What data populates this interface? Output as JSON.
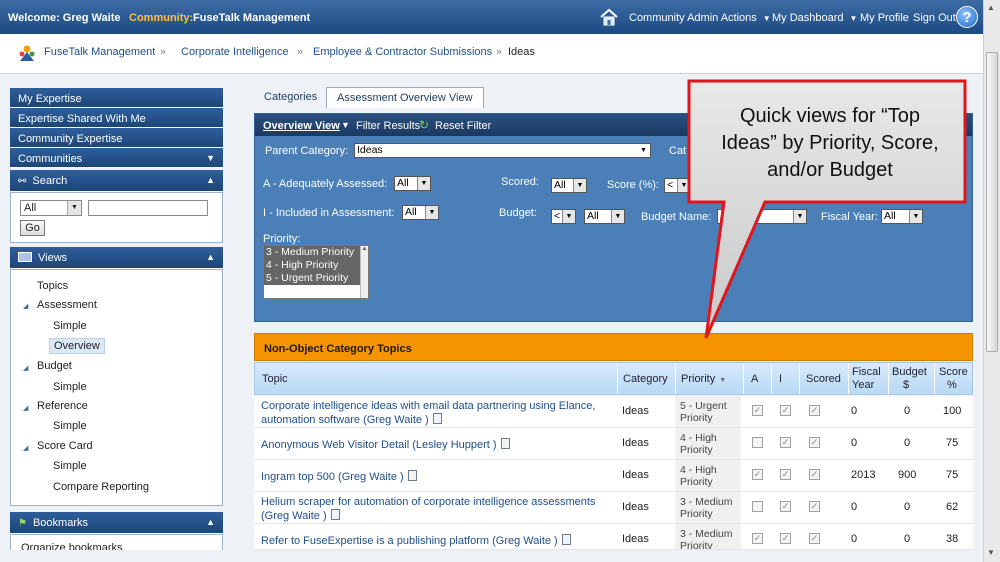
{
  "topbar": {
    "welcome": "Welcome: Greg Waite",
    "community_label": "Community:",
    "community_name": "FuseTalk Management",
    "nav": {
      "admin": "Community Admin Actions",
      "dashboard": "My Dashboard",
      "profile": "My Profile",
      "signout": "Sign Out"
    },
    "help": "?"
  },
  "breadcrumb": [
    "FuseTalk Management",
    "Corporate Intelligence",
    "Employee & Contractor Submissions",
    "Ideas"
  ],
  "breadcrumb_sep": "»",
  "left": {
    "menu": [
      "My Expertise",
      "Expertise Shared With Me",
      "Community Expertise",
      "Communities"
    ],
    "search": {
      "title": "Search",
      "scope": "All",
      "go": "Go"
    },
    "views": {
      "title": "Views",
      "topics": "Topics",
      "assessment": "Assessment",
      "simple1": "Simple",
      "overview": "Overview",
      "budget": "Budget",
      "simple2": "Simple",
      "reference": "Reference",
      "simple3": "Simple",
      "scorecard": "Score Card",
      "simple4": "Simple",
      "compare": "Compare Reporting"
    },
    "bookmarks": {
      "title": "Bookmarks",
      "organize": "Organize bookmarks"
    }
  },
  "tabs": [
    "Categories",
    "Assessment Overview View"
  ],
  "filter": {
    "bar": {
      "overview": "Overview View",
      "filter": "Filter Results",
      "reset": "Reset Filter"
    },
    "parent_label": "Parent Category:",
    "parent_value": "Ideas",
    "cat_label": "Cat",
    "a_label": "A - Adequately Assessed:",
    "a_value": "All",
    "scored_label": "Scored:",
    "scored_value": "All",
    "score_label": "Score (%):",
    "score_op": "<",
    "i_label": "I - Included in Assessment:",
    "i_value": "All",
    "budget_label": "Budget:",
    "budget_op": "<",
    "budget_value": "All",
    "budget_name_label": "Budget Name:",
    "budget_name_value": "All",
    "fiscal_label": "Fiscal Year:",
    "fiscal_value": "All",
    "priority_label": "Priority:",
    "priority_options": [
      "3 - Medium Priority",
      "4 - High Priority",
      "5 - Urgent Priority"
    ]
  },
  "section_title": "Non-Object Category Topics",
  "table": {
    "headers": {
      "topic": "Topic",
      "category": "Category",
      "priority": "Priority",
      "a": "A",
      "i": "I",
      "scored": "Scored",
      "fiscal1": "Fiscal",
      "fiscal2": "Year",
      "budget1": "Budget",
      "budget2": "$",
      "score1": "Score",
      "score2": "%"
    },
    "rows": [
      {
        "topic1": "Corporate intelligence ideas with email data partnering using Elance,",
        "topic2": "automation software (Greg Waite )",
        "category": "Ideas",
        "p1": "5 - Urgent",
        "p2": "Priority",
        "fiscal": "0",
        "budget": "0",
        "score": "100"
      },
      {
        "topic1": "Anonymous Web Visitor Detail (Lesley Huppert )",
        "topic2": "",
        "category": "Ideas",
        "p1": "4 - High",
        "p2": "Priority",
        "fiscal": "0",
        "budget": "0",
        "score": "75"
      },
      {
        "topic1": "Ingram top 500 (Greg Waite )",
        "topic2": "",
        "category": "Ideas",
        "p1": "4 - High",
        "p2": "Priority",
        "fiscal": "2013",
        "budget": "900",
        "score": "75"
      },
      {
        "topic1": "Helium scraper for automation of corporate intelligence assessments",
        "topic2": "(Greg Waite )",
        "category": "Ideas",
        "p1": "3 - Medium",
        "p2": "Priority",
        "fiscal": "0",
        "budget": "0",
        "score": "62"
      },
      {
        "topic1": "Refer to FuseExpertise is a publishing platform (Greg Waite )",
        "topic2": "",
        "category": "Ideas",
        "p1": "3 - Medium",
        "p2": "Priority",
        "fiscal": "0",
        "budget": "0",
        "score": "38"
      }
    ]
  },
  "callout": {
    "line1": "Quick views  for “Top",
    "line2": "Ideas” by Priority, Score,",
    "line3": "and/or Budget"
  },
  "colors": {
    "topbar": "#1d4a82",
    "accent": "#ffc33a",
    "orange": "#f59300",
    "callout_border": "#e0161c",
    "filter_bg": "#4b7fb8"
  }
}
